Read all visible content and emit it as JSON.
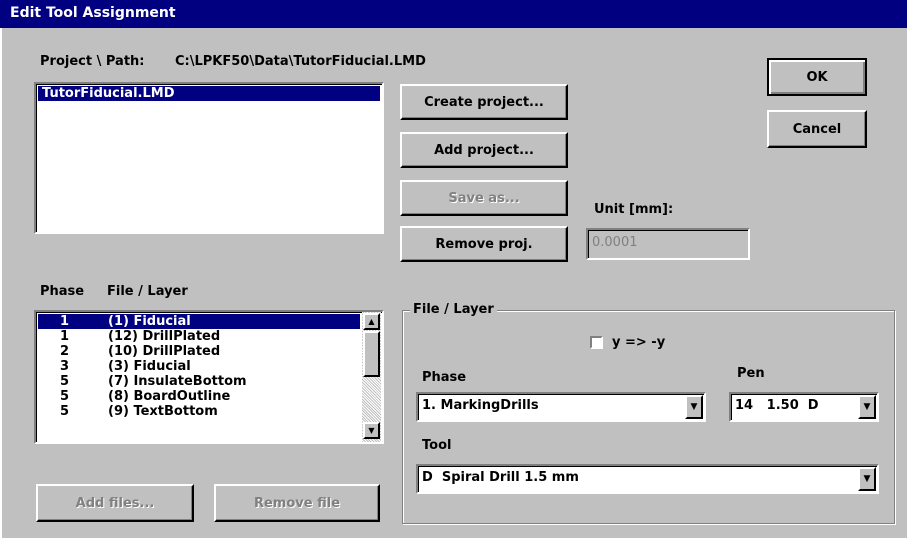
{
  "title": "Edit Tool Assignment",
  "project_path_label": "Project \\ Path:",
  "project_path_value": "C:\\LPKF50\\Data\\TutorFiducial.LMD",
  "projects": [
    "TutorFiducial.LMD"
  ],
  "buttons": {
    "ok": "OK",
    "cancel": "Cancel",
    "create_project": "Create project...",
    "add_project": "Add project...",
    "save_as": "Save as...",
    "remove_proj": "Remove proj.",
    "add_files": "Add files...",
    "remove_file": "Remove file"
  },
  "unit_label": "Unit [mm]:",
  "unit_value": "0.0001",
  "list_headers": {
    "phase": "Phase",
    "file_layer": "File / Layer"
  },
  "layers": [
    {
      "phase": "1",
      "layer": "(1) Fiducial"
    },
    {
      "phase": "1",
      "layer": "(12) DrillPlated"
    },
    {
      "phase": "2",
      "layer": "(10) DrillPlated"
    },
    {
      "phase": "3",
      "layer": "(3) Fiducial"
    },
    {
      "phase": "5",
      "layer": "(7) InsulateBottom"
    },
    {
      "phase": "5",
      "layer": "(8) BoardOutline"
    },
    {
      "phase": "5",
      "layer": "(9) TextBottom"
    }
  ],
  "group": {
    "title": "File / Layer",
    "mirror_label": "y => -y",
    "phase_label": "Phase",
    "phase_value": "1. MarkingDrills",
    "pen_label": "Pen",
    "pen_value": "14   1.50  D",
    "tool_label": "Tool",
    "tool_value": "D  Spiral Drill 1.5 mm"
  }
}
